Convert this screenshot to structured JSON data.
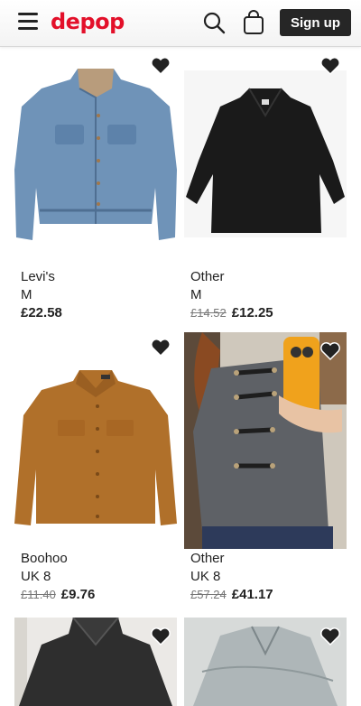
{
  "header": {
    "logo": "depop",
    "signup_label": "Sign up",
    "icons": [
      "menu-icon",
      "search-icon",
      "bag-icon"
    ]
  },
  "products": [
    {
      "brand": "Levi's",
      "size": "M",
      "old_price": "",
      "price": "£22.58"
    },
    {
      "brand": "Other",
      "size": "M",
      "old_price": "£14.52",
      "price": "£12.25"
    },
    {
      "brand": "Boohoo",
      "size": "UK 8",
      "old_price": "£11.40",
      "price": "£9.76"
    },
    {
      "brand": "Other",
      "size": "UK 8",
      "old_price": "£57.24",
      "price": "£41.17"
    },
    {
      "brand": "",
      "size": "",
      "old_price": "",
      "price": ""
    },
    {
      "brand": "",
      "size": "",
      "old_price": "",
      "price": ""
    }
  ],
  "colors": {
    "brand_red": "#e3102a",
    "button_dark": "#262626"
  }
}
